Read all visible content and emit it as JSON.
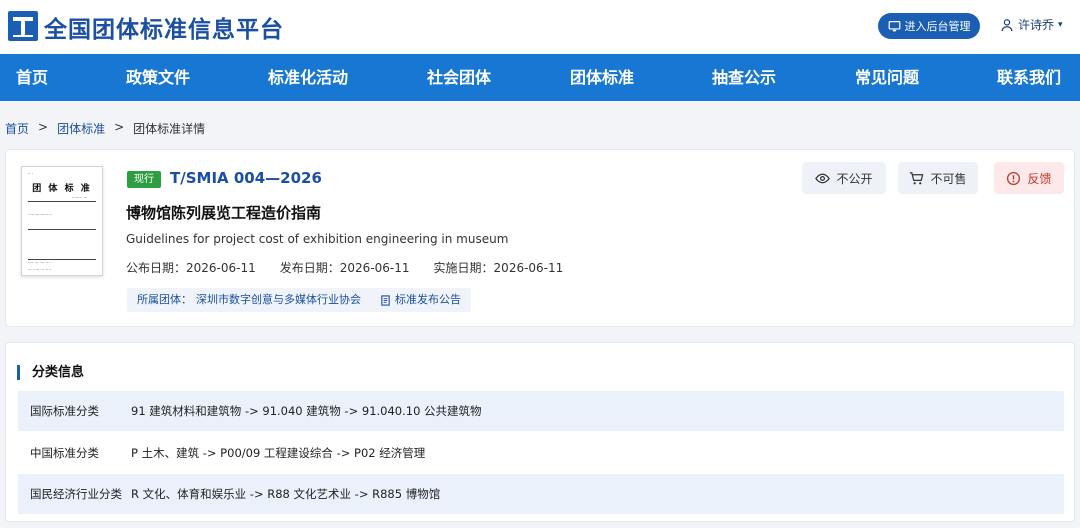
{
  "header": {
    "site_title": "全国团体标准信息平台",
    "admin_button": "进入后台管理",
    "user_name": "许诗乔",
    "logo_icon": "platform-logo-icon"
  },
  "nav": {
    "items": [
      "首页",
      "政策文件",
      "标准化活动",
      "社会团体",
      "团体标准",
      "抽查公示",
      "常见问题",
      "联系我们"
    ]
  },
  "breadcrumb": {
    "home": "首页",
    "sep1": ">",
    "section": "团体标准",
    "sep2": ">",
    "current": "团体标准详情"
  },
  "standard": {
    "cover_title": "团 体 标 准",
    "status": "现行",
    "code": "T/SMIA 004—2026",
    "title_cn": "博物馆陈列展览工程造价指南",
    "title_en": "Guidelines for project cost of exhibition engineering in museum",
    "publish_date_label": "公布日期：",
    "publish_date": "2026-06-11",
    "release_date_label": "发布日期：",
    "release_date": "2026-06-11",
    "implement_date_label": "实施日期：",
    "implement_date": "2026-06-11",
    "org_label": "所属团体：",
    "org_name": "深圳市数字创意与多媒体行业协会",
    "announcement": "标准发布公告",
    "actions": {
      "not_public": "不公开",
      "not_for_sale": "不可售",
      "feedback": "反馈"
    }
  },
  "classification": {
    "title": "分类信息",
    "rows": [
      {
        "label": "国际标准分类",
        "value": "91 建筑材料和建筑物 -> 91.040 建筑物 -> 91.040.10 公共建筑物"
      },
      {
        "label": "中国标准分类",
        "value": "P 土木、建筑 -> P00/09 工程建设综合 -> P02 经济管理"
      },
      {
        "label": "国民经济行业分类",
        "value": "R 文化、体育和娱乐业 -> R88 文化艺术业 -> R885 博物馆"
      }
    ]
  },
  "colors": {
    "brand_blue": "#1a5fb4",
    "nav_blue": "#1877d2",
    "status_green": "#2e9e40",
    "feedback_red": "#c0392b"
  }
}
